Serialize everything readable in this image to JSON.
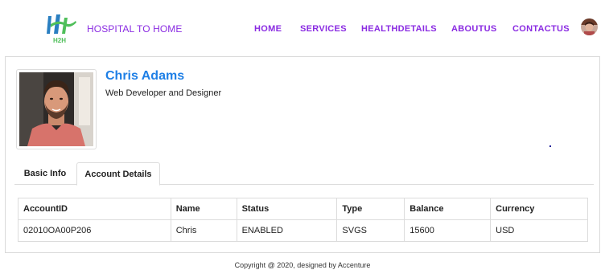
{
  "navbar": {
    "logo_text": "H2H",
    "brand": "HOSPITAL TO HOME",
    "links": [
      "HOME",
      "SERVICES",
      "HEALTHDETAILS",
      "ABOUTUS",
      "CONTACTUS"
    ]
  },
  "profile": {
    "name": "Chris Adams",
    "role": "Web Developer and Designer"
  },
  "tabs": [
    "Basic Info",
    "Account Details"
  ],
  "active_tab": "Account Details",
  "account_table": {
    "headers": [
      "AccountID",
      "Name",
      "Status",
      "Type",
      "Balance",
      "Currency"
    ],
    "rows": [
      [
        "02010OA00P206",
        "Chris",
        "ENABLED",
        "SVGS",
        "15600",
        "USD"
      ]
    ]
  },
  "footer": "Copyright @ 2020, designed by Accenture",
  "colors": {
    "accent_purple": "#8a2be2",
    "name_blue": "#1e7fe6",
    "logo_blue": "#2a7fc1",
    "logo_green": "#4fbf5a"
  }
}
